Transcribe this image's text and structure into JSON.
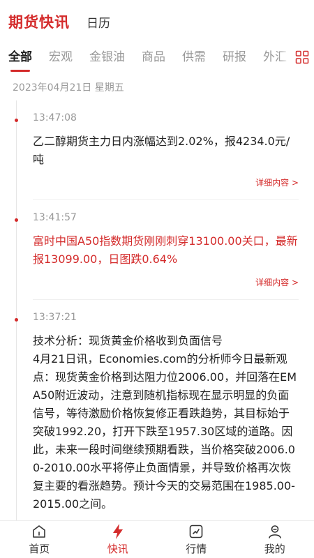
{
  "header": {
    "title": "期货快讯",
    "calendar": "日历"
  },
  "tabs": [
    {
      "label": "全部"
    },
    {
      "label": "宏观"
    },
    {
      "label": "金银油"
    },
    {
      "label": "商品"
    },
    {
      "label": "供需"
    },
    {
      "label": "研报"
    },
    {
      "label": "外汇"
    }
  ],
  "date_line": "2023年04月21日 星期五",
  "feed": [
    {
      "time": "13:47:08",
      "content": "乙二醇期货主力日内涨幅达到2.02%，报4234.0元/吨",
      "more": "详细内容 >",
      "highlight": false
    },
    {
      "time": "13:41:57",
      "content": "富时中国A50指数期货刚刚刺穿13100.00关口，最新报13099.00，日图跌0.64%",
      "more": "详细内容 >",
      "highlight": true
    },
    {
      "time": "13:37:21",
      "content": "技术分析：现货黄金价格收到负面信号\n4月21日讯，Economies.com的分析师今日最新观点：现货黄金价格到达阻力位2006.00，并回落在EMA50附近波动，注意到随机指标现在显示明显的负面信号，等待激励价格恢复修正看跌趋势，其目标始于突破1992.20，打开下跌至1957.30区域的道路。因此，未来一段时间继续预期看跌，当价格突破2006.00-2010.00水平将停止负面情景，并导致价格再次恢复主要的看涨趋势。预计今天的交易范围在1985.00-2015.00之间。",
      "more": "",
      "highlight": false
    }
  ],
  "bottom_nav": [
    {
      "label": "首页",
      "icon": "home-icon"
    },
    {
      "label": "快讯",
      "icon": "lightning-icon"
    },
    {
      "label": "行情",
      "icon": "chart-icon"
    },
    {
      "label": "我的",
      "icon": "user-icon"
    }
  ],
  "colors": {
    "accent": "#d42b2b",
    "muted": "#999999"
  }
}
